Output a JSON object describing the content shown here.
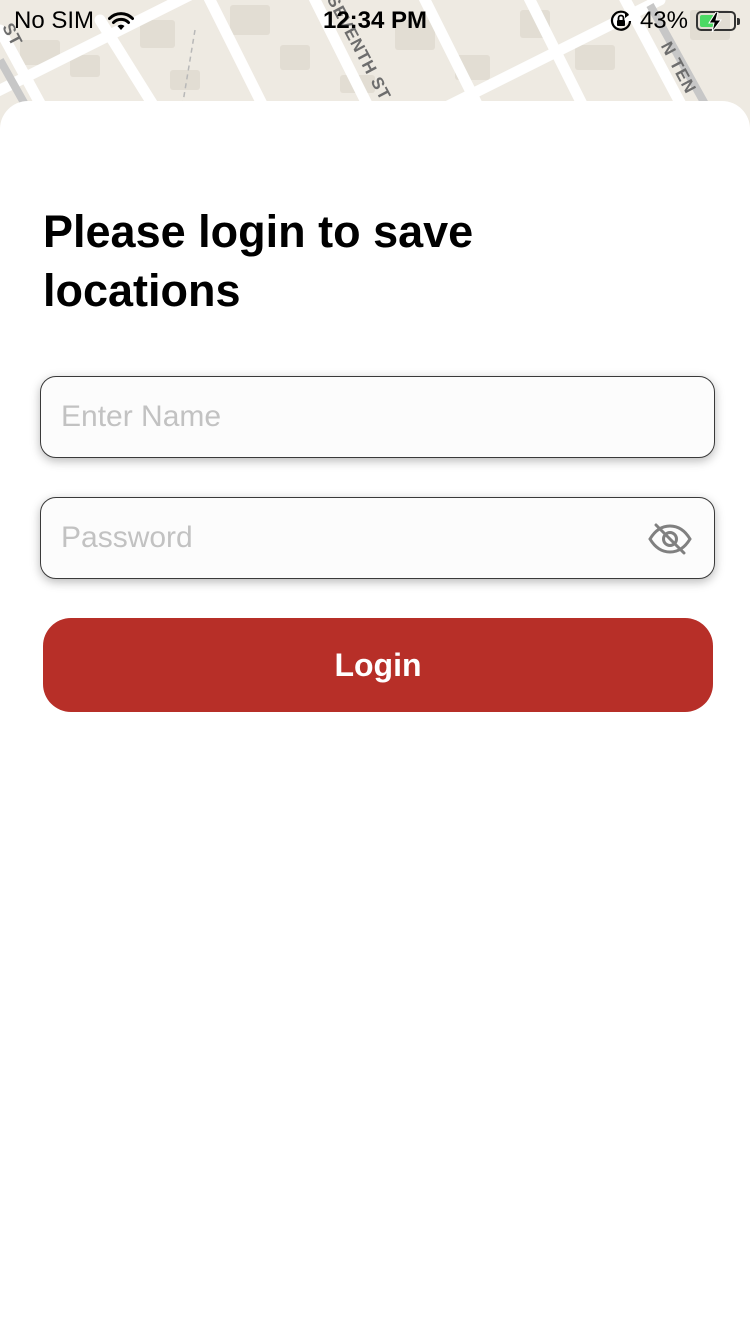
{
  "status_bar": {
    "carrier": "No SIM",
    "time": "12:34 PM",
    "battery_percent": "43%",
    "battery_level": 0.43,
    "battery_charging": true,
    "icons": [
      "wifi-icon",
      "orientation-lock-icon",
      "battery-charging-icon"
    ]
  },
  "map": {
    "street_labels": [
      "ST",
      "SEVENTH ST",
      "N TEN"
    ]
  },
  "login": {
    "title": "Please login to save locations",
    "name_placeholder": "Enter Name",
    "password_placeholder": "Password",
    "button_label": "Login",
    "password_toggle_icon": "eye-slash-icon"
  },
  "colors": {
    "accent": "#b72f28",
    "map_background": "#eeeae2",
    "battery_fill": "#4cd964"
  }
}
